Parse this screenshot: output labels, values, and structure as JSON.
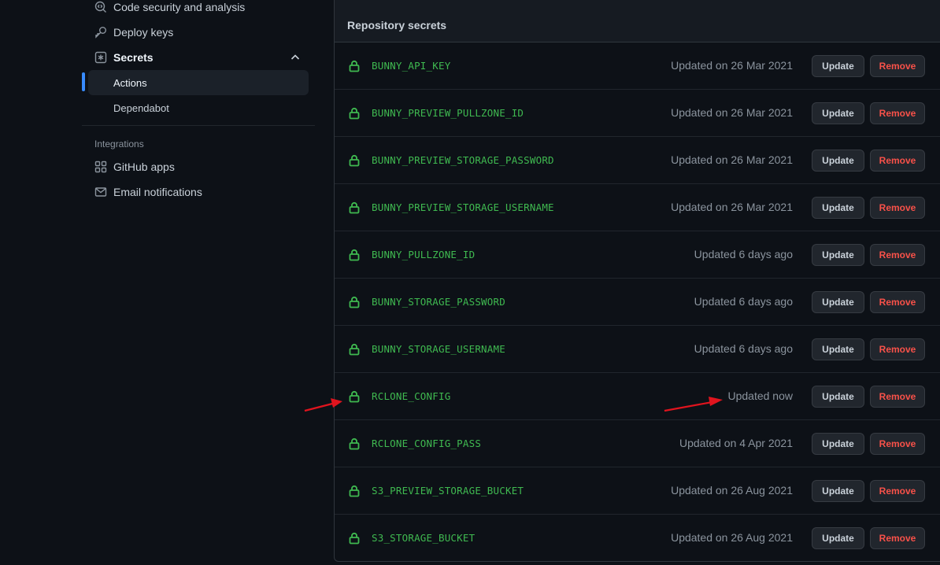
{
  "sidebar": {
    "items": [
      {
        "label": "Code security and analysis",
        "icon": "codescan-icon"
      },
      {
        "label": "Deploy keys",
        "icon": "key-icon"
      },
      {
        "label": "Secrets",
        "icon": "asterisk-icon"
      }
    ],
    "secrets_sub": [
      {
        "label": "Actions"
      },
      {
        "label": "Dependabot"
      }
    ],
    "integrations_label": "Integrations",
    "integrations": [
      {
        "label": "GitHub apps",
        "icon": "apps-icon"
      },
      {
        "label": "Email notifications",
        "icon": "mail-icon"
      }
    ]
  },
  "secrets": {
    "title": "Repository secrets",
    "update_label": "Update",
    "remove_label": "Remove",
    "rows": [
      {
        "name": "BUNNY_API_KEY",
        "updated": "Updated on 26 Mar 2021"
      },
      {
        "name": "BUNNY_PREVIEW_PULLZONE_ID",
        "updated": "Updated on 26 Mar 2021"
      },
      {
        "name": "BUNNY_PREVIEW_STORAGE_PASSWORD",
        "updated": "Updated on 26 Mar 2021"
      },
      {
        "name": "BUNNY_PREVIEW_STORAGE_USERNAME",
        "updated": "Updated on 26 Mar 2021"
      },
      {
        "name": "BUNNY_PULLZONE_ID",
        "updated": "Updated 6 days ago"
      },
      {
        "name": "BUNNY_STORAGE_PASSWORD",
        "updated": "Updated 6 days ago"
      },
      {
        "name": "BUNNY_STORAGE_USERNAME",
        "updated": "Updated 6 days ago"
      },
      {
        "name": "RCLONE_CONFIG",
        "updated": "Updated now"
      },
      {
        "name": "RCLONE_CONFIG_PASS",
        "updated": "Updated on 4 Apr 2021"
      },
      {
        "name": "S3_PREVIEW_STORAGE_BUCKET",
        "updated": "Updated on 26 Aug 2021"
      },
      {
        "name": "S3_STORAGE_BUCKET",
        "updated": "Updated on 26 Aug 2021"
      }
    ]
  },
  "colors": {
    "background": "#0d1117",
    "secret_name": "#3fb950",
    "remove_text": "#f85149",
    "active_indicator": "#388bfd",
    "annotation_arrow": "#e0141e"
  }
}
